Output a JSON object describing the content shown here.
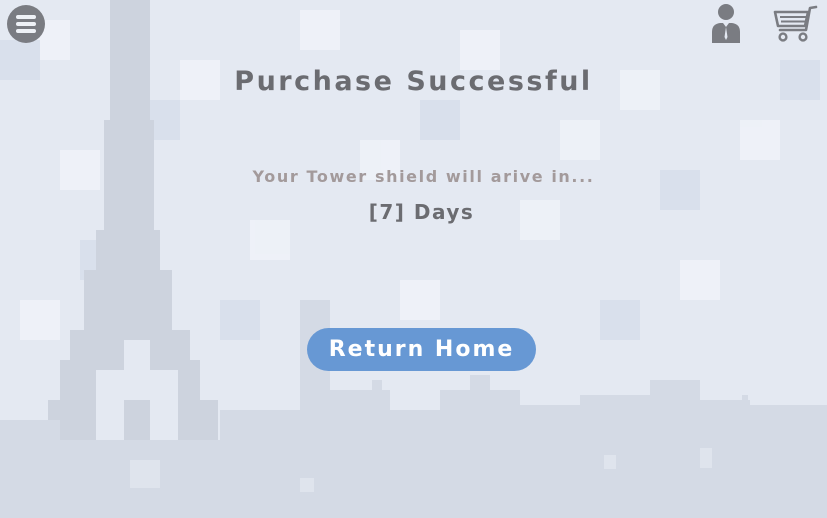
{
  "header": {
    "menu_icon": "hamburger-menu-icon",
    "account_icon": "user-account-icon",
    "cart_icon": "shopping-cart-icon"
  },
  "confirmation": {
    "title": "Purchase Successful",
    "message": "Your Tower shield will arive in...",
    "delivery_time": "[7] Days"
  },
  "actions": {
    "return_home_label": "Return Home"
  },
  "background": {
    "scene": "pixelated-paris-skyline",
    "landmark_icon": "eiffel-tower-icon"
  },
  "colors": {
    "background": "#e4e9f2",
    "silhouette": "#cdd3de",
    "title_text": "#6b6c71",
    "message_text": "#a39a9b",
    "button": "#6798d4",
    "button_text": "#ffffff",
    "icon": "#7a7c82"
  }
}
